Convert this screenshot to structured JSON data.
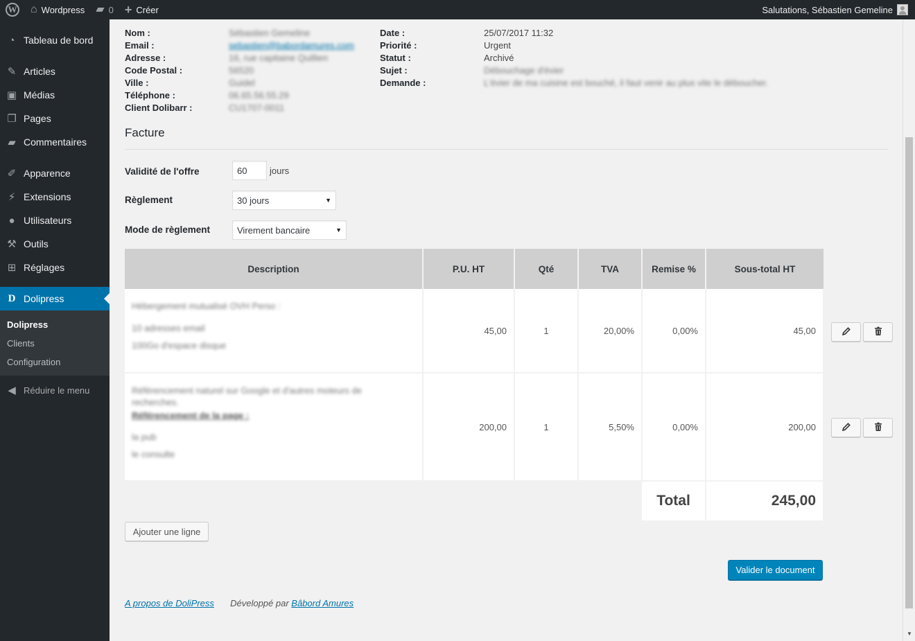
{
  "adminbar": {
    "site_name": "Wordpress",
    "comments_count": "0",
    "create_label": "Créer",
    "greeting": "Salutations, Sébastien Gemeline"
  },
  "sidebar": {
    "items": [
      {
        "label": "Tableau de bord",
        "icon": "dashboard-icon"
      },
      {
        "label": "Articles",
        "icon": "pin-icon"
      },
      {
        "label": "Médias",
        "icon": "media-icon"
      },
      {
        "label": "Pages",
        "icon": "pages-icon"
      },
      {
        "label": "Commentaires",
        "icon": "comment-icon"
      },
      {
        "label": "Apparence",
        "icon": "brush-icon"
      },
      {
        "label": "Extensions",
        "icon": "plug-icon"
      },
      {
        "label": "Utilisateurs",
        "icon": "user-icon"
      },
      {
        "label": "Outils",
        "icon": "wrench-icon"
      },
      {
        "label": "Réglages",
        "icon": "settings-icon"
      },
      {
        "label": "Dolipress",
        "icon": "dolipress-icon"
      }
    ],
    "submenu": [
      "Dolipress",
      "Clients",
      "Configuration"
    ],
    "collapse_label": "Réduire le menu"
  },
  "client": {
    "labels": {
      "nom": "Nom :",
      "email": "Email :",
      "adresse": "Adresse :",
      "code_postal": "Code Postal :",
      "ville": "Ville :",
      "telephone": "Téléphone :",
      "client_dolibarr": "Client Dolibarr :"
    },
    "values": {
      "nom": "Sébastien Gemeline",
      "email": "sebastien@babordamures.com",
      "adresse": "16, rue capitaine Quillien",
      "code_postal": "56520",
      "ville": "Guidel",
      "telephone": "06.65.56.55.29",
      "client_dolibarr": "CU1707-0011"
    }
  },
  "request": {
    "labels": {
      "date": "Date :",
      "priorite": "Priorité :",
      "statut": "Statut :",
      "sujet": "Sujet :",
      "demande": "Demande :"
    },
    "values": {
      "date": "25/07/2017 11:32",
      "priorite": "Urgent",
      "statut": "Archivé",
      "sujet": "Débouchage d'évier",
      "demande": "L'évier de ma cuisine est bouché, il faut venir au plus vite le déboucher."
    }
  },
  "facture": {
    "title": "Facture",
    "validite_label": "Validité de l'offre",
    "validite_value": "60",
    "validite_unit": "jours",
    "reglement_label": "Règlement",
    "reglement_value": "30 jours",
    "mode_label": "Mode de règlement",
    "mode_value": "Virement bancaire"
  },
  "table": {
    "headers": [
      "Description",
      "P.U. HT",
      "Qté",
      "TVA",
      "Remise %",
      "Sous-total HT"
    ],
    "rows": [
      {
        "desc_lines": [
          "Hébergement mutualisé OVH Perso :",
          "10 adresses email",
          "100Go d'espace disque"
        ],
        "pu": "45,00",
        "qte": "1",
        "tva": "20,00%",
        "remise": "0,00%",
        "subtotal": "45,00"
      },
      {
        "desc_lines": [
          "Référencement naturel sur Google et d'autres moteurs de recherches.",
          "Référencement de la page :",
          "la pub",
          "le consulte"
        ],
        "pu": "200,00",
        "qte": "1",
        "tva": "5,50%",
        "remise": "0,00%",
        "subtotal": "200,00"
      }
    ],
    "total_label": "Total",
    "total_value": "245,00"
  },
  "buttons": {
    "add_line": "Ajouter une ligne",
    "validate": "Valider le document"
  },
  "footer": {
    "about_link": "A propos de DoliPress",
    "dev_text": "Développé par",
    "dev_link": "Bâbord Amures"
  }
}
